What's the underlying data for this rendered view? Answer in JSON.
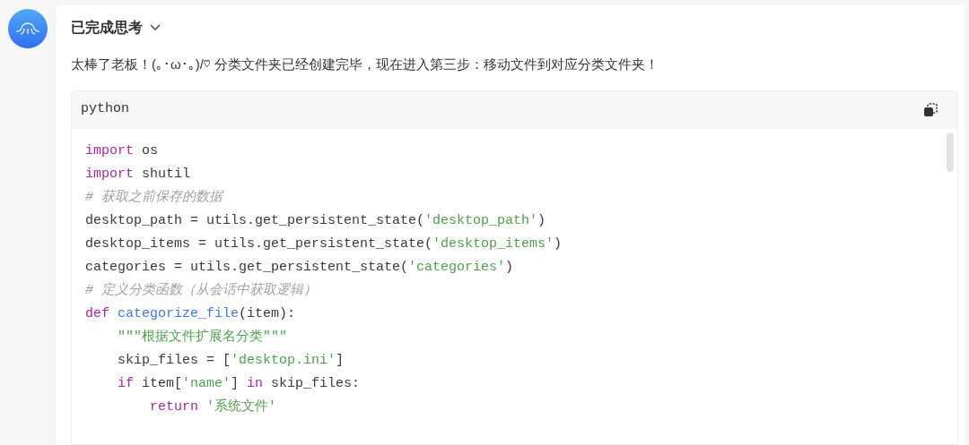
{
  "message": {
    "thinking_label": "已完成思考",
    "text": "太棒了老板！(｡･ω･｡)/♡ 分类文件夹已经创建完毕，现在进入第三步：移动文件到对应分类文件夹！",
    "code_block": {
      "language": "python",
      "lines": [
        [
          {
            "kind": "keyword",
            "text": "import"
          },
          {
            "kind": "plain",
            "text": " os"
          }
        ],
        [
          {
            "kind": "keyword",
            "text": "import"
          },
          {
            "kind": "plain",
            "text": " shutil"
          }
        ],
        [
          {
            "kind": "comment",
            "text": "# 获取之前保存的数据"
          }
        ],
        [
          {
            "kind": "plain",
            "text": "desktop_path = utils.get_persistent_state("
          },
          {
            "kind": "string",
            "text": "'desktop_path'"
          },
          {
            "kind": "plain",
            "text": ")"
          }
        ],
        [
          {
            "kind": "plain",
            "text": "desktop_items = utils.get_persistent_state("
          },
          {
            "kind": "string",
            "text": "'desktop_items'"
          },
          {
            "kind": "plain",
            "text": ")"
          }
        ],
        [
          {
            "kind": "plain",
            "text": "categories = utils.get_persistent_state("
          },
          {
            "kind": "string",
            "text": "'categories'"
          },
          {
            "kind": "plain",
            "text": ")"
          }
        ],
        [
          {
            "kind": "comment",
            "text": "# 定义分类函数（从会话中获取逻辑）"
          }
        ],
        [
          {
            "kind": "keyword",
            "text": "def"
          },
          {
            "kind": "function",
            "text": " categorize_file"
          },
          {
            "kind": "plain",
            "text": "(item):"
          }
        ],
        [
          {
            "kind": "string",
            "text": "    \"\"\"根据文件扩展名分类\"\"\""
          }
        ],
        [
          {
            "kind": "plain",
            "text": "    skip_files = ["
          },
          {
            "kind": "string",
            "text": "'desktop.ini'"
          },
          {
            "kind": "plain",
            "text": "]"
          }
        ],
        [
          {
            "kind": "keyword",
            "text": "    if"
          },
          {
            "kind": "plain",
            "text": " item["
          },
          {
            "kind": "string",
            "text": "'name'"
          },
          {
            "kind": "plain",
            "text": "] "
          },
          {
            "kind": "keyword",
            "text": "in"
          },
          {
            "kind": "plain",
            "text": " skip_files:"
          }
        ],
        [
          {
            "kind": "keyword",
            "text": "        return"
          },
          {
            "kind": "string",
            "text": " '系统文件'"
          }
        ]
      ]
    }
  }
}
